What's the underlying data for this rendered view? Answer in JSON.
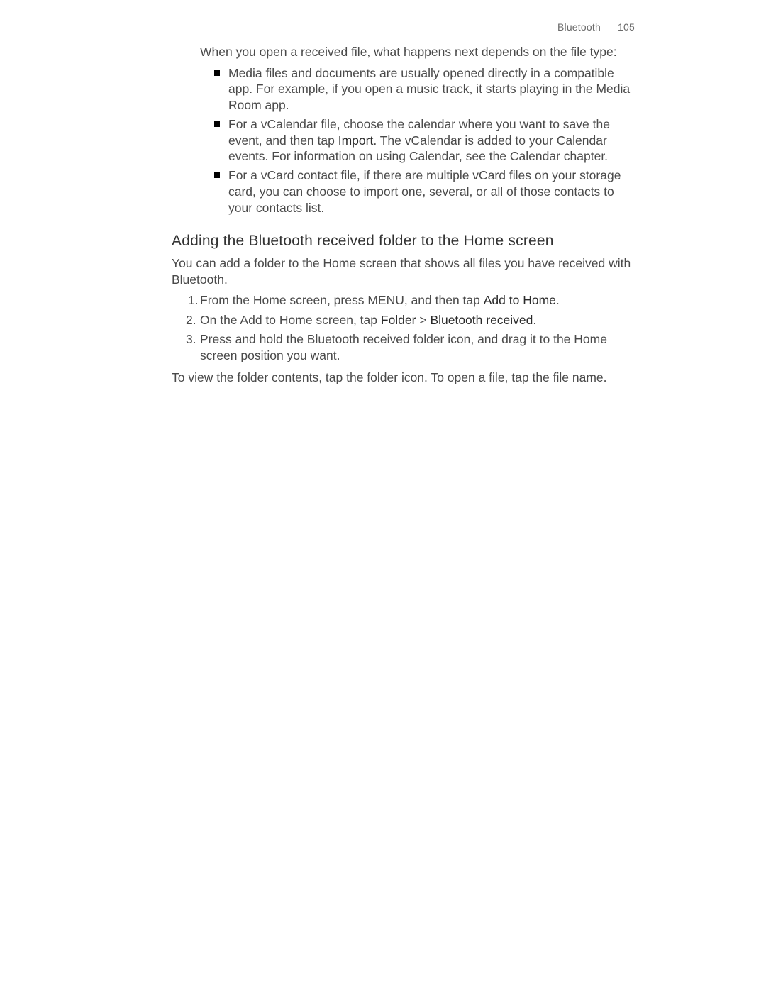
{
  "header": {
    "section": "Bluetooth",
    "page_number": "105"
  },
  "intro": "When you open a received file, what happens next depends on the file type:",
  "bullets": {
    "b1": "Media files and documents are usually opened directly in a compatible app. For example, if you open a music track, it starts playing in the Media Room app.",
    "b2_pre": "For a vCalendar file, choose the calendar where you want to save the event, and then tap ",
    "b2_strong": "Import",
    "b2_post": ". The vCalendar is added to your Calendar events. For information on using Calendar, see the Calendar chapter.",
    "b3": "For a vCard contact file, if there are multiple vCard files on your storage card, you can choose to import one, several, or all of those contacts to your contacts list."
  },
  "heading": "Adding the Bluetooth received folder to the Home screen",
  "heading_intro": "You can add a folder to the Home screen that shows all files you have received with Bluetooth.",
  "steps": {
    "s1_pre": "From the Home screen, press MENU, and then tap ",
    "s1_strong": "Add to Home",
    "s1_post": ".",
    "s2_pre": "On the Add to Home screen, tap ",
    "s2_strong1": "Folder",
    "s2_mid": " > ",
    "s2_strong2": "Bluetooth received",
    "s2_post": ".",
    "s3": "Press and hold the Bluetooth received folder icon, and drag it to the Home screen position you want."
  },
  "closing": "To view the folder contents, tap the folder icon. To open a file, tap the file name."
}
